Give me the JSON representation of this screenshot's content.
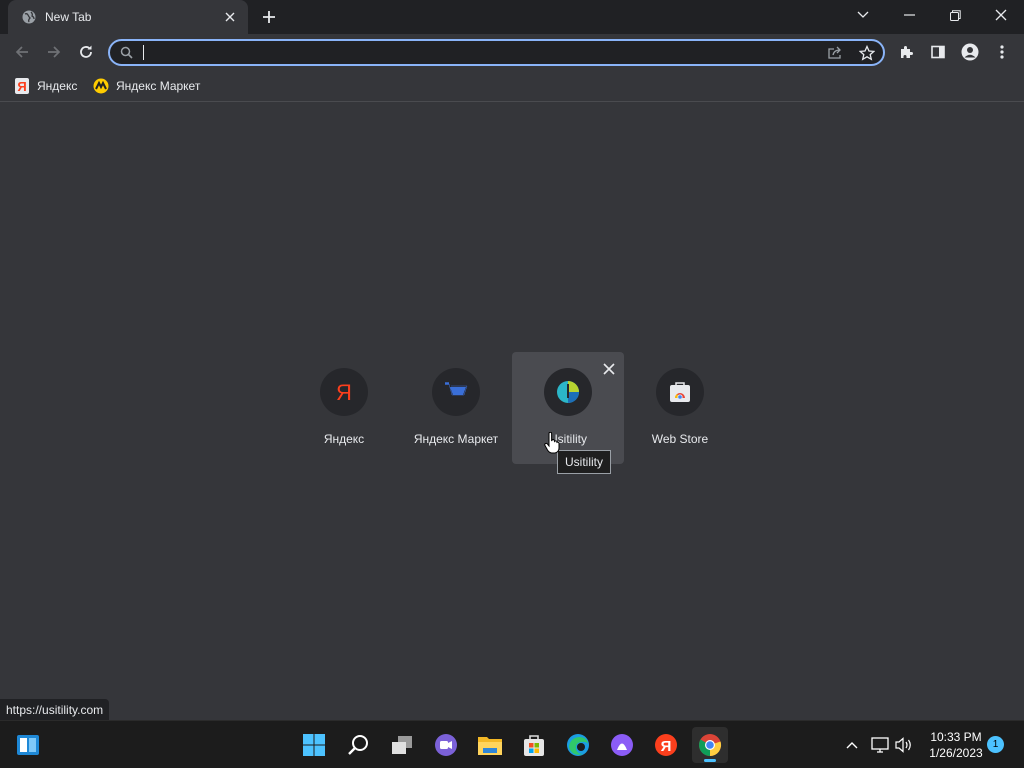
{
  "tab": {
    "title": "New Tab",
    "favicon": "globe-icon"
  },
  "window_controls": [
    "chevron-down-icon",
    "minimize-icon",
    "restore-icon",
    "close-icon"
  ],
  "omnibox": {
    "value": "",
    "placeholder": ""
  },
  "bookmarks": [
    {
      "label": "Яндекс",
      "icon": "yandex-icon",
      "color": "#fc3f1d"
    },
    {
      "label": "Яндекс Маркет",
      "icon": "yandex-market-icon",
      "color": "#ffcc00"
    }
  ],
  "shortcuts": [
    {
      "label": "Яндекс",
      "icon": "yandex-icon",
      "color": "#fc3f1d"
    },
    {
      "label": "Яндекс Маркет",
      "icon": "yandex-market-icon",
      "color": "#3a6fd8"
    },
    {
      "label": "Usitility",
      "icon": "usitility-icon",
      "color": "#2bb6c8",
      "hovered": true
    },
    {
      "label": "Web Store",
      "icon": "web-store-icon",
      "color": "#ea4335"
    }
  ],
  "tooltip": "Usitility",
  "status_url": "https://usitility.com",
  "taskbar": {
    "apps": [
      "start-icon",
      "search-icon",
      "task-view-icon",
      "teams-chat-icon",
      "file-explorer-icon",
      "microsoft-store-icon",
      "edge-icon",
      "alice-icon",
      "yandex-browser-icon",
      "chrome-icon"
    ],
    "active_app": "chrome-icon"
  },
  "clock": {
    "time": "10:33 PM",
    "date": "1/26/2023"
  },
  "notification_count": "1"
}
